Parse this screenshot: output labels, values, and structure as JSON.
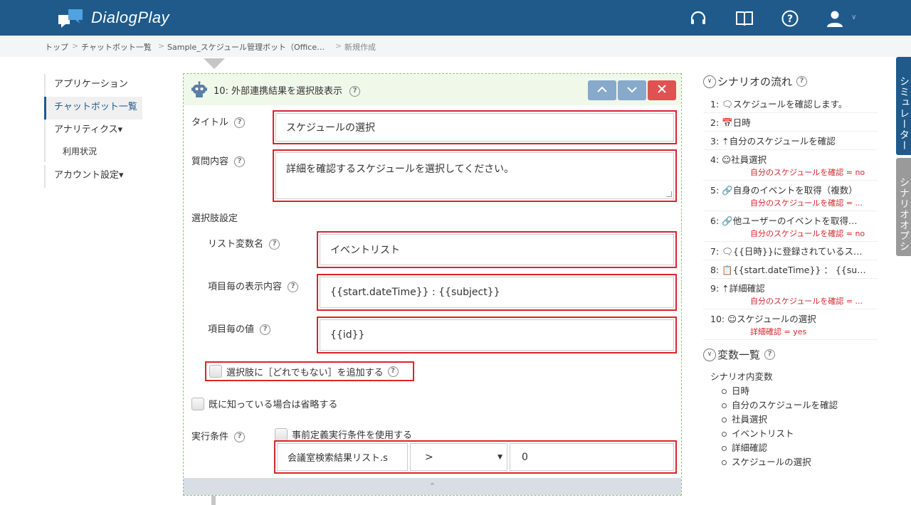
{
  "header": {
    "app_name": "DialogPlay",
    "icons": [
      "headset-icon",
      "book-icon",
      "help-icon",
      "user-icon"
    ],
    "color": "#1f5a8b"
  },
  "breadcrumb": {
    "items": [
      "トップ",
      "チャットボット一覧",
      "Sample_スケジュール管理ボット（Office…"
    ],
    "current": "新規作成"
  },
  "sidebar": {
    "items": [
      {
        "label": "アプリケーション"
      },
      {
        "label": "チャットボット一覧"
      },
      {
        "label": "アナリティクス▾"
      },
      {
        "label": "利用状況"
      },
      {
        "label": "アカウント設定▾"
      }
    ]
  },
  "editor": {
    "title": "10: 外部連携結果を選択肢表示",
    "title_label": "タイトル",
    "title_value": "スケジュールの選択",
    "question_label": "質問内容",
    "question_value": "詳細を確認するスケジュールを選択してください。",
    "choice_settings_label": "選択肢設定",
    "list_var_label": "リスト変数名",
    "list_var_value": "イベントリスト",
    "display_label": "項目毎の表示内容",
    "display_value": "{{start.dateTime}} : {{subject}}",
    "value_label": "項目毎の値",
    "value_value": "{{id}}",
    "add_none_label": "選択肢に［どれでもない］を追加する",
    "skip_known_label": "既に知っている場合は省略する",
    "exec_cond_label": "実行条件",
    "predefined_label": "事前定義実行条件を使用する",
    "cond_var": "会議室検索結果リスト.s",
    "cond_op": ">",
    "cond_value": "0",
    "collapse_glyph": "⌃"
  },
  "flow": {
    "heading": "シナリオの流れ",
    "items": [
      {
        "text": "1: 🗨スケジュールを確認します。",
        "cond": ""
      },
      {
        "text": "2: 📅日時",
        "cond": ""
      },
      {
        "text": "3: ⇡自分のスケジュールを確認",
        "cond": ""
      },
      {
        "text": "4: ☺社員選択",
        "cond": "自分のスケジュールを確認 = no"
      },
      {
        "text": "5: 🔗自身のイベントを取得（複数）",
        "cond": "自分のスケジュールを確認 = ..."
      },
      {
        "text": "6: 🔗他ユーザーのイベントを取得…",
        "cond": "自分のスケジュールを確認 = no"
      },
      {
        "text": "7: 🗨{{日時}}に登録されているス…",
        "cond": ""
      },
      {
        "text": "8: 📋{{start.dateTime}} ： {{su…",
        "cond": ""
      },
      {
        "text": "9: ⇡詳細確認",
        "cond": "自分のスケジュールを確認 = ..."
      },
      {
        "text": "10: ☺スケジュールの選択",
        "cond": "詳細確認 = yes"
      }
    ]
  },
  "variables": {
    "heading": "変数一覧",
    "scope": "シナリオ内変数",
    "items": [
      "日時",
      "自分のスケジュールを確認",
      "社員選択",
      "イベントリスト",
      "詳細確認",
      "スケジュールの選択"
    ]
  },
  "side_tabs": {
    "simulator": "シミュレーター",
    "options": "シナリオオプション"
  }
}
